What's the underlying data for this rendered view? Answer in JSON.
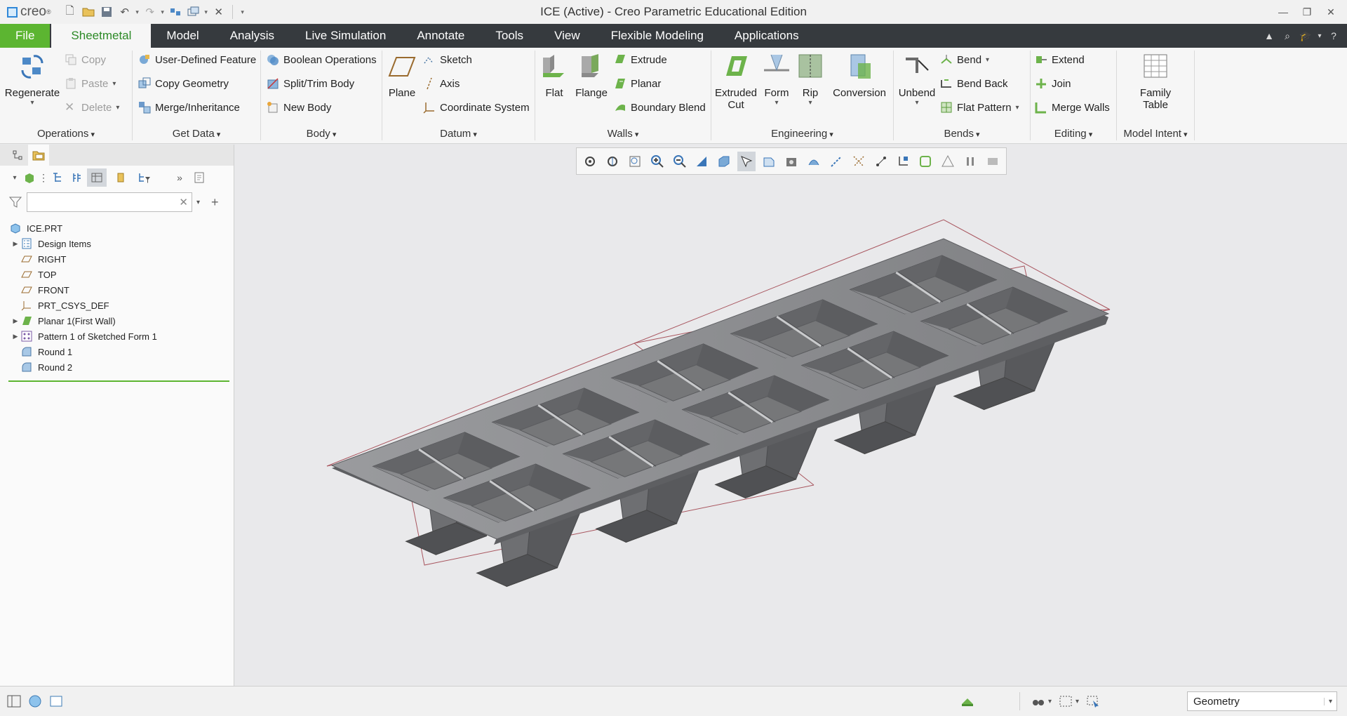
{
  "window": {
    "title": "ICE (Active) - Creo Parametric Educational Edition",
    "logo_text": "creo"
  },
  "menu": {
    "tabs": [
      "File",
      "Sheetmetal",
      "Model",
      "Analysis",
      "Live Simulation",
      "Annotate",
      "Tools",
      "View",
      "Flexible Modeling",
      "Applications"
    ],
    "active_tab": "Sheetmetal"
  },
  "ribbon": {
    "operations": {
      "label": "Operations",
      "regenerate": "Regenerate",
      "copy": "Copy",
      "paste": "Paste",
      "delete": "Delete"
    },
    "get_data": {
      "label": "Get Data",
      "udf": "User-Defined Feature",
      "copy_geometry": "Copy Geometry",
      "merge_inheritance": "Merge/Inheritance"
    },
    "body": {
      "label": "Body",
      "boolean": "Boolean Operations",
      "split_trim": "Split/Trim Body",
      "new_body": "New Body"
    },
    "datum": {
      "label": "Datum",
      "plane": "Plane",
      "sketch": "Sketch",
      "axis": "Axis",
      "csys": "Coordinate System"
    },
    "walls": {
      "label": "Walls",
      "flat": "Flat",
      "flange": "Flange",
      "extrude": "Extrude",
      "planar": "Planar",
      "boundary_blend": "Boundary Blend"
    },
    "engineering": {
      "label": "Engineering",
      "extruded_cut_1": "Extruded",
      "extruded_cut_2": "Cut",
      "form": "Form",
      "rip": "Rip",
      "conversion": "Conversion"
    },
    "bends": {
      "label": "Bends",
      "unbend": "Unbend",
      "bend": "Bend",
      "bend_back": "Bend Back",
      "flat_pattern": "Flat Pattern"
    },
    "editing": {
      "label": "Editing",
      "extend": "Extend",
      "join": "Join",
      "merge_walls": "Merge Walls"
    },
    "model_intent": {
      "label": "Model Intent",
      "family_table_1": "Family",
      "family_table_2": "Table"
    }
  },
  "model_tree": {
    "search_value": "",
    "items": [
      {
        "label": "ICE.PRT"
      },
      {
        "label": "Design Items"
      },
      {
        "label": "RIGHT"
      },
      {
        "label": "TOP"
      },
      {
        "label": "FRONT"
      },
      {
        "label": "PRT_CSYS_DEF"
      },
      {
        "label": "Planar 1(First Wall)"
      },
      {
        "label": "Pattern 1 of Sketched Form 1"
      },
      {
        "label": "Round 1"
      },
      {
        "label": "Round 2"
      }
    ]
  },
  "status": {
    "selection_filter": "Geometry"
  },
  "colors": {
    "file_tab": "#5cb531",
    "menubar": "#363a3e",
    "active_tab_text": "#2d8a27",
    "model_top": "#8d8e91",
    "model_side": "#5b5c5f",
    "datum_plane": "#a8555e"
  }
}
